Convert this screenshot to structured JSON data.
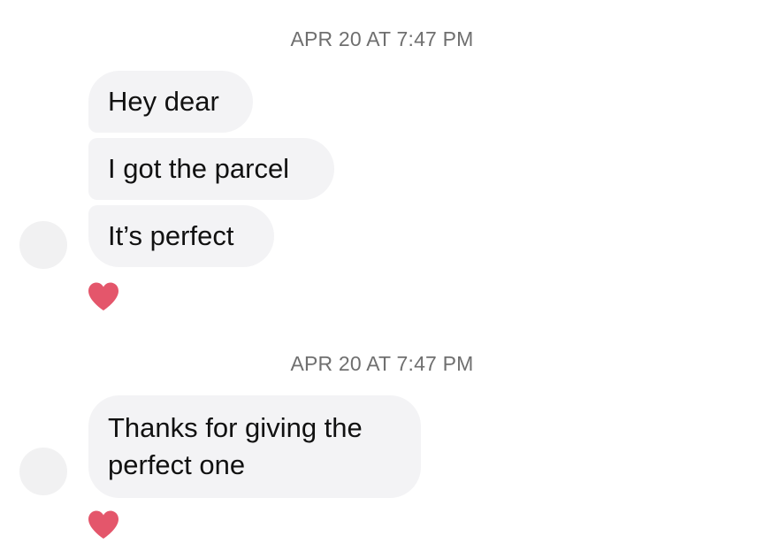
{
  "thread": {
    "groups": [
      {
        "timestamp": "APR 20 AT 7:47 PM",
        "messages": [
          "Hey dear",
          "I got the parcel",
          "It’s perfect"
        ],
        "reaction": "heart-icon"
      },
      {
        "timestamp": "APR 20 AT 7:47 PM",
        "messages": [
          "Thanks for giving the perfect one"
        ],
        "reaction": "heart-icon"
      }
    ]
  },
  "colors": {
    "bubble_bg": "#f3f3f5",
    "timestamp_text": "#6f6f6f",
    "heart": "#e4566b"
  }
}
